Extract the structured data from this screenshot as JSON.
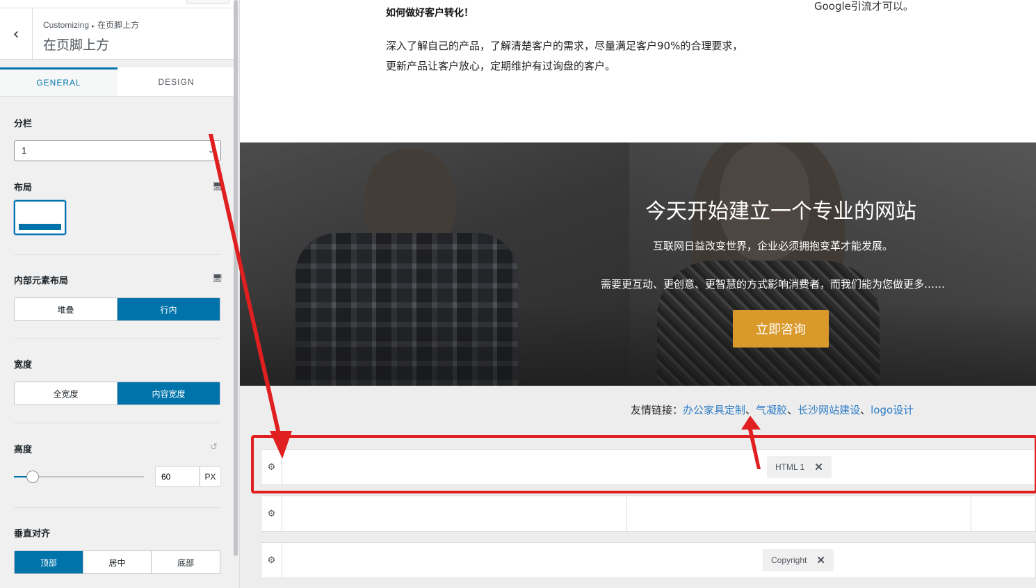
{
  "sidebar": {
    "breadcrumb": {
      "root": "Customizing",
      "separator": "▸",
      "current": "在页脚上方"
    },
    "section_title": "在页脚上方",
    "tabs": [
      {
        "label": "GENERAL",
        "active": true
      },
      {
        "label": "DESIGN",
        "active": false
      }
    ],
    "columns": {
      "label": "分栏",
      "value": "1"
    },
    "layout": {
      "label": "布局"
    },
    "inner_layout": {
      "label": "内部元素布局",
      "options": [
        "堆叠",
        "行内"
      ],
      "selected": "行内"
    },
    "width": {
      "label": "宽度",
      "options": [
        "全宽度",
        "内容宽度"
      ],
      "selected": "内容宽度"
    },
    "height": {
      "label": "高度",
      "value": "60",
      "unit": "PX",
      "slider_fraction": 0.147
    },
    "vertical_align": {
      "label": "垂直对齐",
      "options": [
        "顶部",
        "居中",
        "底部"
      ],
      "selected": "顶部"
    }
  },
  "preview": {
    "heading": "如何做好客户转化！",
    "paragraph": "深入了解自己的产品，了解清楚客户的需求，尽量满足客户90%的合理要求，更新产品让客户放心，定期维护有过询盘的客户。",
    "right_text": "Google引流才可以。",
    "hero": {
      "title": "今天开始建立一个专业的网站",
      "sub1": "互联网日益改变世界，企业必须拥抱变革才能发展。",
      "sub2": "需要更互动、更创意、更智慧的方式影响消费者，而我们能为您做更多……",
      "button": "立即咨询"
    },
    "friend_links": {
      "label": "友情链接：",
      "separator": "、",
      "items": [
        "办公家具定制",
        "气凝胶",
        "长沙网站建设",
        "logo设计"
      ]
    },
    "footer_rows": {
      "row1_chip": "HTML 1",
      "row3_chip": "Copyright",
      "chip_close": "✕"
    }
  },
  "colors": {
    "accent": "#0073aa",
    "hero_button": "#d99a2b",
    "link": "#2b7bc6",
    "annotation": "#e02020"
  }
}
